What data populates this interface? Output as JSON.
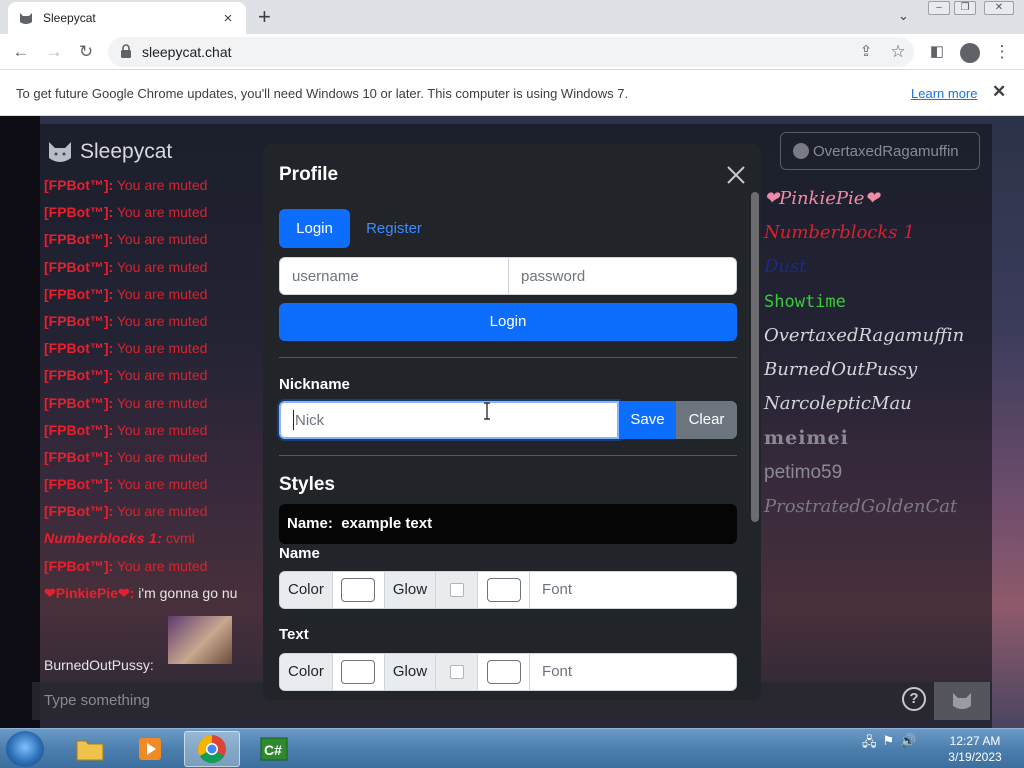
{
  "browser": {
    "tab_title": "Sleepycat",
    "tab_close_icon": "×",
    "new_tab_icon": "+",
    "url": "sleepycat.chat"
  },
  "infobar": {
    "message": "To get future Google Chrome updates, you'll need Windows 10 or later. This computer is using Windows 7.",
    "link": "Learn more",
    "close": "✕"
  },
  "app": {
    "brand": "Sleepycat",
    "user_button": "OvertaxedRagamuffin",
    "chat_placeholder": "Type something",
    "help_icon": "?"
  },
  "chat": {
    "muted_sender": "[FPBot™]:",
    "muted_text": "You are muted",
    "muted_count": 13,
    "lines": [
      {
        "sender": "Numberblocks 1:",
        "text": "cvml"
      },
      {
        "sender": "[FPBot™]:",
        "text": "You are muted"
      },
      {
        "sender": "❤PinkiePie❤:",
        "text": "i'm gonna go nu"
      }
    ],
    "last_sender": "BurnedOutPussy:"
  },
  "userlist": [
    {
      "name": "❤PinkiePie❤",
      "color": "#f08aa8",
      "style": "italic"
    },
    {
      "name": "Numberblocks 1",
      "color": "#e01e2a",
      "style": "italic"
    },
    {
      "name": "Dust",
      "color": "#1a2a8a",
      "style": "italic"
    },
    {
      "name": "Showtime",
      "color": "#3cc93c",
      "style": "mono"
    },
    {
      "name": "OvertaxedRagamuffin",
      "color": "#d4d4da",
      "style": "italic"
    },
    {
      "name": "BurnedOutPussy",
      "color": "#d4d4da",
      "style": "italic"
    },
    {
      "name": "NarcolepticMau",
      "color": "#d4d4da",
      "style": "italic"
    },
    {
      "name": "meimei",
      "color": "#8a8a92",
      "style": "bold-serif"
    },
    {
      "name": "petimo59",
      "color": "#8a8a92",
      "style": "normal"
    },
    {
      "name": "ProstratedGoldenCat",
      "color": "#7a7a82",
      "style": "italic"
    }
  ],
  "modal": {
    "title": "Profile",
    "tabs": [
      "Login",
      "Register"
    ],
    "username_placeholder": "username",
    "password_placeholder": "password",
    "login_button": "Login",
    "nickname_label": "Nickname",
    "nick_placeholder": "Nick",
    "save_button": "Save",
    "clear_button": "Clear",
    "styles_heading": "Styles",
    "preview_name": "Name:",
    "preview_text": "example text",
    "name_section": "Name",
    "text_section": "Text",
    "color_label": "Color",
    "glow_label": "Glow",
    "font_placeholder": "Font"
  },
  "taskbar": {
    "time": "12:27 AM",
    "date": "3/19/2023",
    "apps": [
      "File Explorer",
      "Media Player",
      "Google Chrome",
      "C#"
    ]
  },
  "colors": {
    "primary": "#0d6efd",
    "modal_bg": "#212529",
    "muted_red": "#d6242e"
  }
}
